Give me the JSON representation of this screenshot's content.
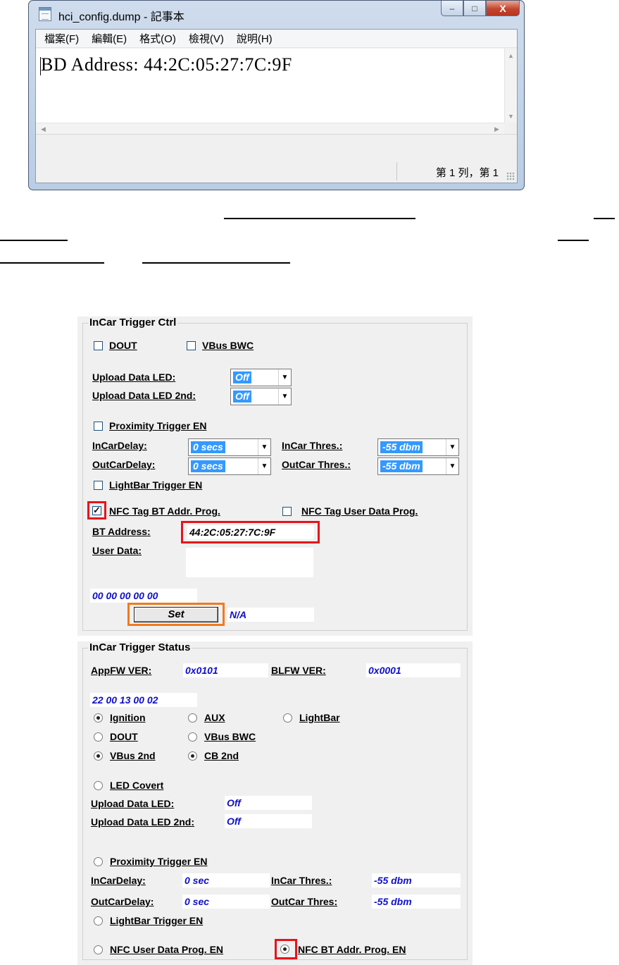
{
  "notepad": {
    "title": "hci_config.dump - 記事本",
    "menus": [
      "檔案(F)",
      "編輯(E)",
      "格式(O)",
      "檢視(V)",
      "說明(H)"
    ],
    "content": "BD Address: 44:2C:05:27:7C:9F",
    "status": "第 1 列，第 1",
    "controls": {
      "minimize": "–",
      "maximize": "□",
      "close": "X"
    }
  },
  "ctrl": {
    "legend": "InCar Trigger Ctrl",
    "dout": {
      "label": "DOUT",
      "checked": false
    },
    "vbus_bwc": {
      "label": "VBus BWC",
      "checked": false
    },
    "upload_led_label": "Upload Data LED:",
    "upload_led_value": "Off",
    "upload_led2_label": "Upload Data LED 2nd:",
    "upload_led2_value": "Off",
    "proximity": {
      "label": "Proximity Trigger EN",
      "checked": false
    },
    "incar_delay_label": "InCarDelay:",
    "incar_delay_value": "0 secs",
    "outcar_delay_label": "OutCarDelay:",
    "outcar_delay_value": "0 secs",
    "incar_thres_label": "InCar Thres.:",
    "incar_thres_value": "-55 dbm",
    "outcar_thres_label": "OutCar Thres.:",
    "outcar_thres_value": "-55 dbm",
    "lightbar": {
      "label": "LightBar Trigger EN",
      "checked": false
    },
    "nfc_bt": {
      "label": "NFC Tag BT Addr. Prog.",
      "checked": true
    },
    "nfc_user": {
      "label": "NFC Tag User Data Prog.",
      "checked": false
    },
    "bt_address_label": "BT Address:",
    "bt_address_value": "44:2C:05:27:7C:9F",
    "user_data_label": "User Data:",
    "user_data_value": "",
    "hex_value": "00 00 00 00 00",
    "set_button": "Set",
    "set_status": "N/A"
  },
  "status": {
    "legend": "InCar Trigger Status",
    "appfw_label": "AppFW VER:",
    "appfw_value": "0x0101",
    "blfw_label": "BLFW VER:",
    "blfw_value": "0x0001",
    "hex_value": "22 00 13 00 02",
    "radios": {
      "ignition": {
        "label": "Ignition",
        "on": true
      },
      "aux": {
        "label": "AUX",
        "on": false
      },
      "lightbar": {
        "label": "LightBar",
        "on": false
      },
      "dout": {
        "label": "DOUT",
        "on": false
      },
      "vbus_bwc": {
        "label": "VBus BWC",
        "on": false
      },
      "vbus2": {
        "label": "VBus 2nd",
        "on": true
      },
      "cb2": {
        "label": "CB 2nd",
        "on": true
      },
      "led_covert": {
        "label": "LED Covert",
        "on": false
      },
      "proximity": {
        "label": "Proximity Trigger EN",
        "on": false
      },
      "lightbar_trigger": {
        "label": "LightBar Trigger EN",
        "on": false
      },
      "nfc_user": {
        "label": "NFC User Data Prog. EN",
        "on": false
      },
      "nfc_bt": {
        "label": "NFC BT Addr. Prog. EN",
        "on": true
      }
    },
    "upload_led_label": "Upload Data LED:",
    "upload_led_value": "Off",
    "upload_led2_label": "Upload Data LED 2nd:",
    "upload_led2_value": "Off",
    "incar_delay_label": "InCarDelay:",
    "incar_delay_value": "0 sec",
    "outcar_delay_label": "OutCarDelay:",
    "outcar_delay_value": "0 sec",
    "incar_thres_label": "InCar Thres.:",
    "incar_thres_value": "-55 dbm",
    "outcar_thres_label": "OutCar Thres:",
    "outcar_thres_value": "-55 dbm"
  },
  "colors": {
    "highlight_red": "#e8131b",
    "highlight_orange": "#f07a1f",
    "value_blue": "#1010c8",
    "selection_blue": "#3399ff"
  }
}
